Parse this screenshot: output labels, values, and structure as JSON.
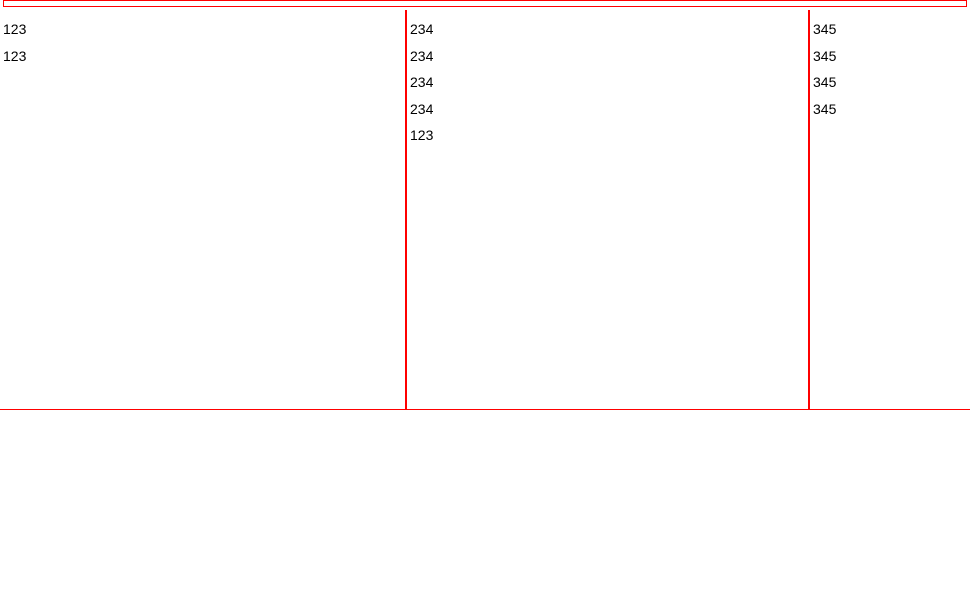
{
  "columns": {
    "col1": [
      "123",
      "123"
    ],
    "col2": [
      "234",
      "234",
      "234",
      "234",
      "123"
    ],
    "col3": [
      "345",
      "345",
      "345",
      "345"
    ]
  }
}
